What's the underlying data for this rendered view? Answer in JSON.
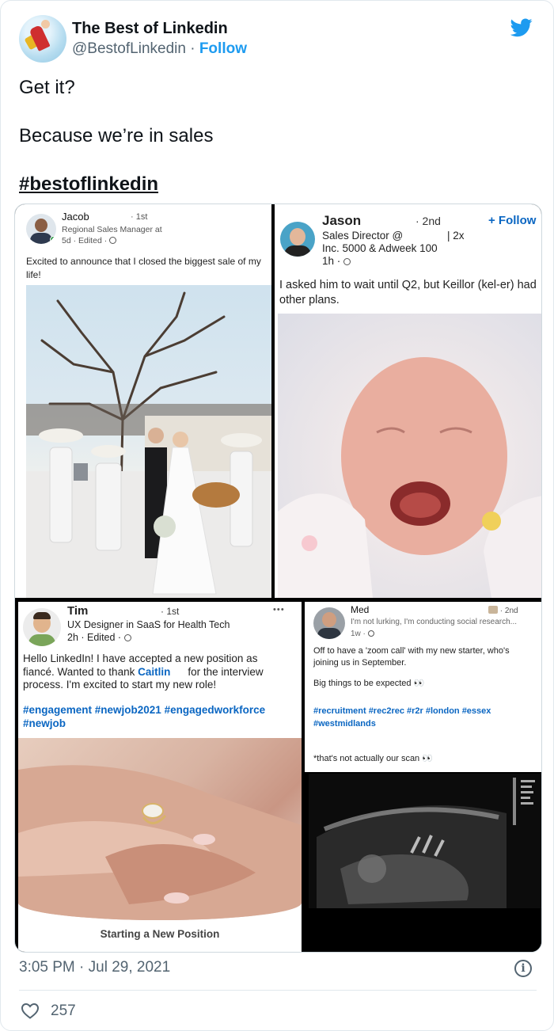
{
  "author": {
    "name": "The Best of Linkedin",
    "handle": "@BestofLinkedin",
    "separator": "·",
    "follow_label": "Follow",
    "avatar": "superhero-avatar"
  },
  "platform_icon": "twitter-bird-icon",
  "tweet_lines": [
    "Get it?",
    "Because we’re in sales",
    "#bestoflinkedin"
  ],
  "posts": {
    "jacob": {
      "name": "Jacob",
      "degree": "· 1st",
      "title": "Regional Sales Manager at",
      "meta": "5d · Edited ·",
      "body": "Excited to announce that I closed the biggest sale of my life!"
    },
    "jason": {
      "name": "Jason",
      "degree": "· 2nd",
      "follow": "+ Follow",
      "title_1": "Sales Director @",
      "title_1b": "| 2x",
      "title_2": "Inc. 5000 & Adweek 100",
      "meta": "1h ·",
      "body": "I asked him to wait until Q2, but Keillor (kel-er) had other plans."
    },
    "tim": {
      "name": "Tim",
      "degree": "· 1st",
      "more": "• • •",
      "title": "UX Designer in SaaS for Health Tech",
      "meta": "2h · Edited ·",
      "body_1": "Hello LinkedIn! I have accepted a new position as",
      "body_2a": "fiancé. Wanted to thank ",
      "body_2link": "Caitlin",
      "body_2b": "for the interview",
      "body_3": "process. I'm excited to start my new role!",
      "tags_1": "#engagement #newjob2021 #engagedworkforce",
      "tags_2": "#newjob",
      "caption": "Starting a New Position"
    },
    "med": {
      "name": "Med",
      "degree": "· 2nd",
      "title": "I'm not lurking, I'm conducting social research...",
      "meta": "1w ·",
      "body_1": "Off to have a 'zoom call' with my new starter, who's",
      "body_2": "joining us in September.",
      "body_3": "Big things to be expected 👀",
      "tags_1": "#recruitment #rec2rec #r2r #london #essex",
      "tags_2": "#westmidlands",
      "note": "*that's not actually our scan 👀"
    }
  },
  "footer": {
    "time": "3:05 PM · Jul 29, 2021",
    "likes": "257"
  },
  "colors": {
    "twitter_blue": "#1d9bf0",
    "linkedin_blue": "#0a66c2",
    "text": "#0f1419",
    "muted": "#536471"
  }
}
